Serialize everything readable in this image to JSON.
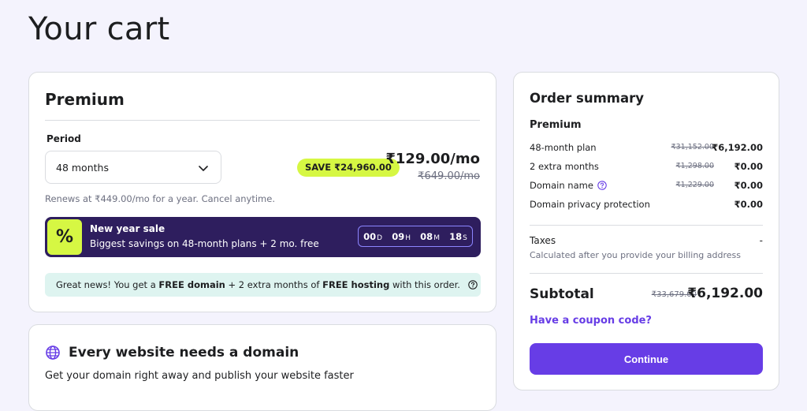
{
  "page": {
    "title": "Your cart"
  },
  "plan": {
    "name": "Premium",
    "period_label": "Period",
    "period_value": "48 months",
    "save_badge": "SAVE ₹24,960.00",
    "price": "₹129.00/mo",
    "old_price": "₹649.00/mo",
    "renews": "Renews at ₹449.00/mo for a year. Cancel anytime.",
    "sale": {
      "icon": "percent-icon",
      "title": "New year sale",
      "desc": "Biggest savings on 48-month plans + 2 mo. free",
      "timer": {
        "d": "00",
        "d_unit": "D",
        "h": "09",
        "h_unit": "H",
        "m": "08",
        "m_unit": "M",
        "s": "18",
        "s_unit": "S"
      }
    },
    "info": {
      "p1": "Great news! You get a ",
      "b1": "FREE domain",
      "p2": " + 2 extra months of ",
      "b2": "FREE hosting",
      "p3": " with this order."
    }
  },
  "domain": {
    "title": "Every website needs a domain",
    "subtitle": "Get your domain right away and publish your website faster"
  },
  "summary": {
    "title": "Order summary",
    "subtitle": "Premium",
    "rows": [
      {
        "label": "48-month plan",
        "old": "₹31,152.00",
        "new": "₹6,192.00"
      },
      {
        "label": "2 extra months",
        "old": "₹1,298.00",
        "new": "₹0.00"
      },
      {
        "label": "Domain name",
        "old": "₹1,229.00",
        "new": "₹0.00"
      },
      {
        "label": "Domain privacy protection",
        "old": "",
        "new": "₹0.00"
      }
    ],
    "taxes_label": "Taxes",
    "taxes_value": "-",
    "taxes_note": "Calculated after you provide your billing address",
    "subtotal_label": "Subtotal",
    "subtotal_old": "₹33,679.00",
    "subtotal_new": "₹6,192.00",
    "coupon": "Have a coupon code?",
    "continue": "Continue"
  },
  "colors": {
    "accent": "#673de6",
    "lime": "#d6f743",
    "banner": "#2e1e5e",
    "info_bg": "#def4f0"
  }
}
